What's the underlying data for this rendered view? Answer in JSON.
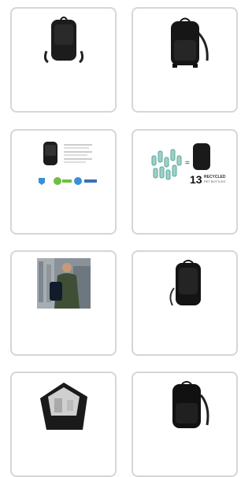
{
  "gallery": {
    "items": [
      {
        "icon": "backpack-front-icon"
      },
      {
        "icon": "backpack-angled-icon"
      },
      {
        "icon": "backpack-features-icon"
      },
      {
        "icon": "recycled-bottles-icon",
        "recycled": {
          "count": "13",
          "label": "RECYCLED",
          "sublabel": "PET BOTTLES"
        }
      },
      {
        "icon": "man-with-backpack-photo"
      },
      {
        "icon": "backpack-back-icon"
      },
      {
        "icon": "backpack-open-compartment-icon"
      },
      {
        "icon": "backpack-side-icon"
      }
    ]
  }
}
